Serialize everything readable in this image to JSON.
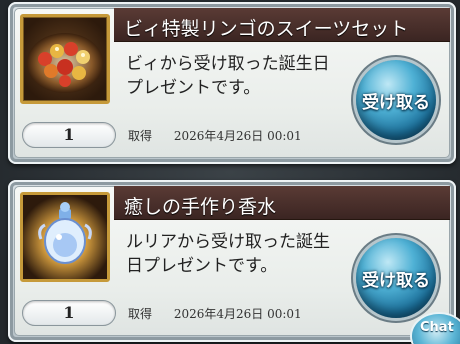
{
  "items": [
    {
      "title": "ビィ特製リンゴのスイーツセット",
      "description": "ビィから受け取った誕生日プレゼントです。",
      "quantity": "1",
      "acquired_label": "取得",
      "acquired_date": "2026年4月26日 00:01",
      "receive_label": "受け取る",
      "thumb_icon": "apple-sweets-platter-icon"
    },
    {
      "title": "癒しの手作り香水",
      "description": "ルリアから受け取った誕生日プレゼントです。",
      "quantity": "1",
      "acquired_label": "取得",
      "acquired_date": "2026年4月26日 00:01",
      "receive_label": "受け取る",
      "thumb_icon": "perfume-bottle-icon"
    }
  ],
  "chat_label": "Chat",
  "colors": {
    "title_bar": "#4a2f2a",
    "button_blue": "#4fb1d5",
    "thumb_border": "#c69a3a"
  }
}
